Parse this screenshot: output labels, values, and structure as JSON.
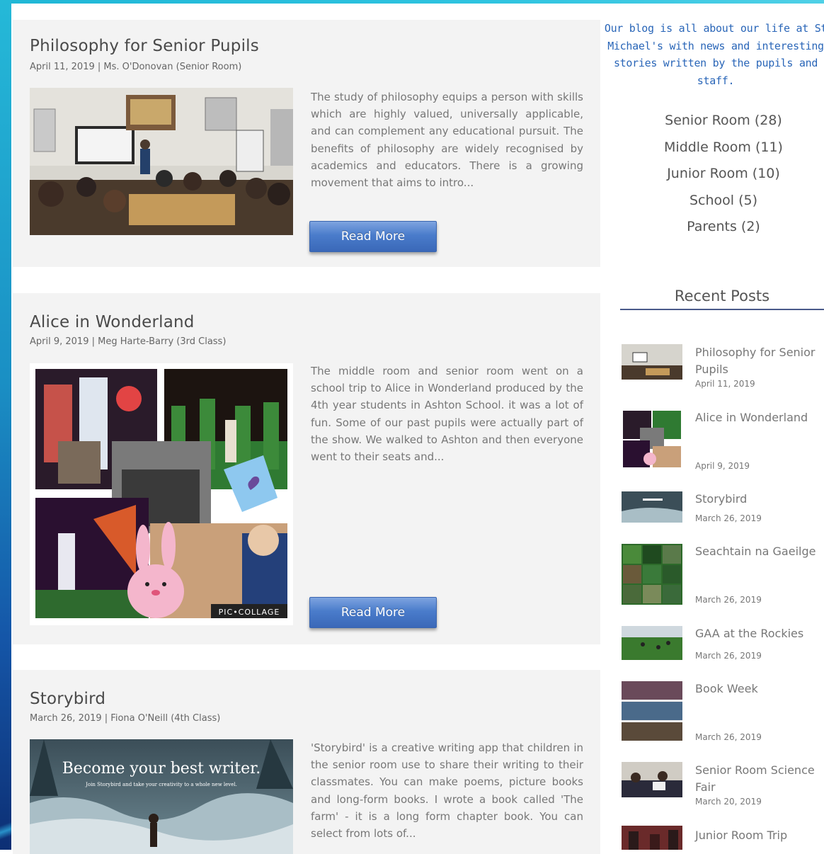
{
  "posts": [
    {
      "title": "Philosophy for Senior Pupils",
      "meta": "April 11, 2019   | Ms. O'Donovan (Senior Room)",
      "excerpt": "The study of philosophy equips a person with skills which are highly valued, universally applicable, and can complement any educational pursuit. The benefits of philosophy are widely recognised by academics and educators. There is a growing movement that aims to intro...",
      "read_more": "Read More"
    },
    {
      "title": "Alice in Wonderland",
      "meta": "April 9, 2019   | Meg Harte-Barry (3rd Class)",
      "excerpt": "The middle room and senior room went on a school trip to Alice in Wonderland produced by the 4th year students in Ashton School.  it was a lot of fun. Some of our past pupils were actually part of the show. We walked to Ashton and then everyone went to their seats  and...",
      "read_more": "Read More",
      "image_caption": "PIC•COLLAGE"
    },
    {
      "title": "Storybird",
      "meta": "March 26, 2019   | Fiona O'Neill (4th Class)",
      "excerpt": "'Storybird' is a creative writing app that children in the senior room use to share their writing to their classmates. You can make poems, picture books and long-form books. I wrote a book called 'The farm' - it is a long form chapter book. You can select from lots of...",
      "image_headline": "Become your best writer.",
      "image_subline": "Join Storybird and take your creativity to a whole new level."
    }
  ],
  "sidebar": {
    "intro": "Our blog is all about our life at St Michael's with news and interesting stories written by the pupils and staff.",
    "categories": [
      "Senior Room (28)",
      "Middle Room (11)",
      "Junior Room (10)",
      "School (5)",
      "Parents (2)"
    ],
    "recent_heading": "Recent Posts",
    "recent": [
      {
        "title": "Philosophy for Senior Pupils",
        "date": "April 11, 2019"
      },
      {
        "title": "Alice in Wonderland",
        "date": "April 9, 2019"
      },
      {
        "title": "Storybird",
        "date": "March 26, 2019"
      },
      {
        "title": "Seachtain na Gaeilge",
        "date": "March 26, 2019"
      },
      {
        "title": "GAA at the Rockies",
        "date": "March 26, 2019"
      },
      {
        "title": "Book Week",
        "date": "March 26, 2019"
      },
      {
        "title": "Senior Room Science Fair",
        "date": "March 20, 2019"
      },
      {
        "title": "Junior Room Trip",
        "date": ""
      }
    ]
  },
  "colors": {
    "accent_blue": "#2a66b8",
    "button_blue": "#4a7ccb",
    "card_bg": "#f3f3f3",
    "frame_cyan": "#1fb7d6"
  }
}
